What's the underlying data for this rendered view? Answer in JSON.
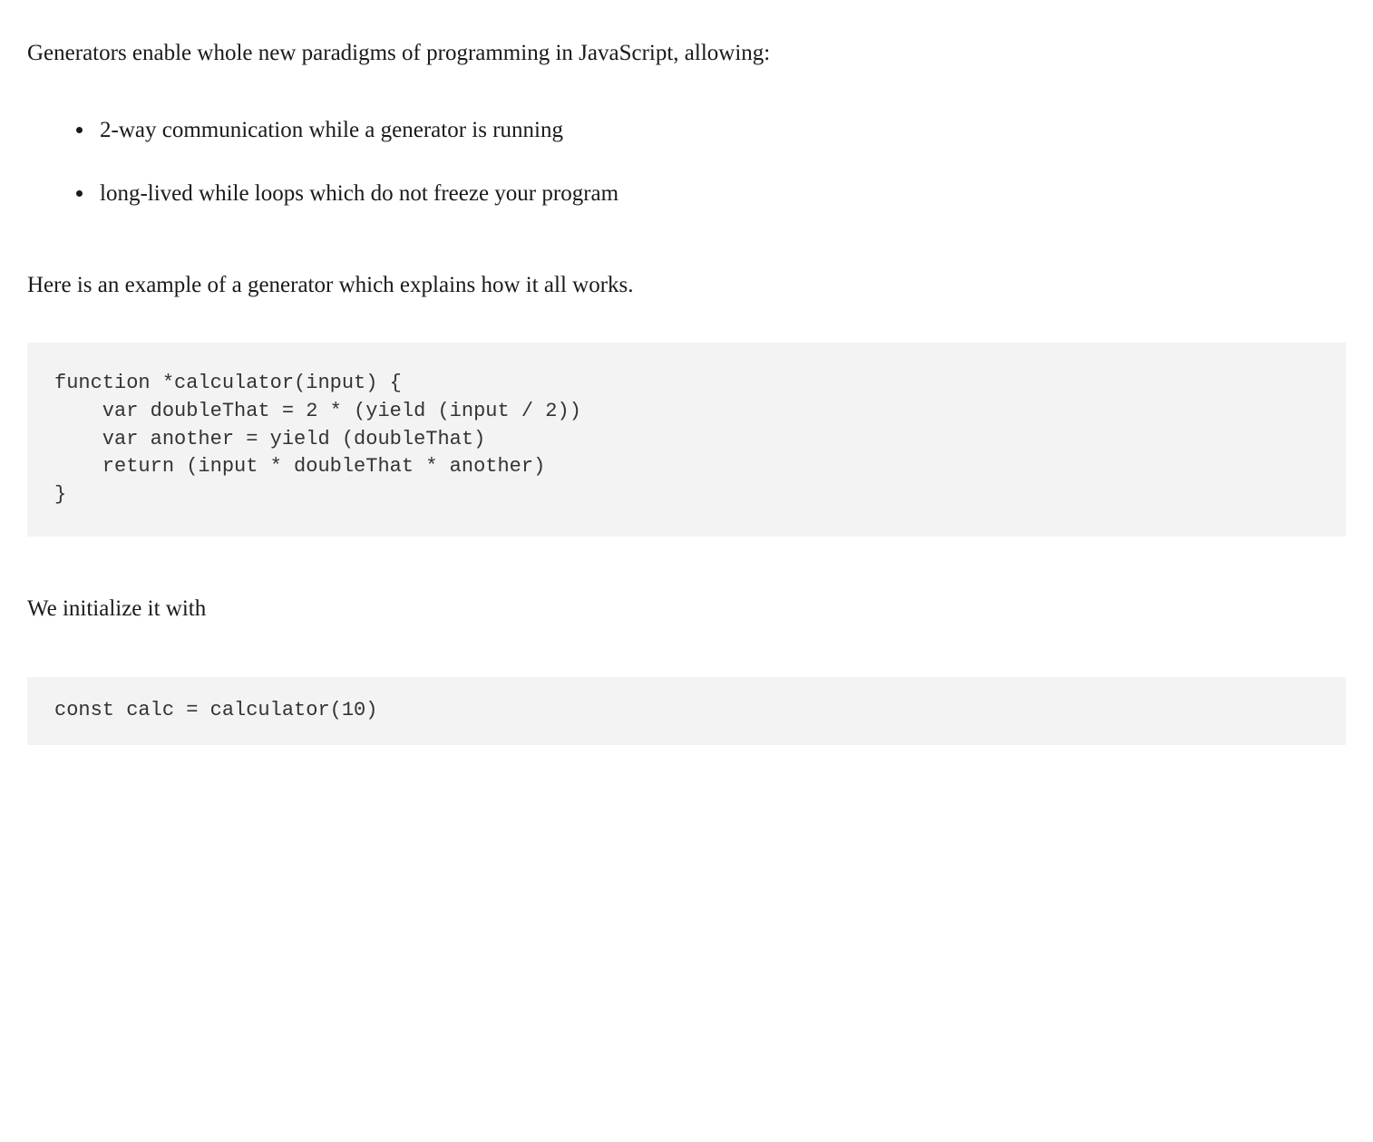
{
  "intro": "Generators enable whole new paradigms of programming in JavaScript, allowing:",
  "bullets": [
    "2-way communication while a generator is running",
    "long-lived while loops which do not freeze your program"
  ],
  "example_intro": "Here is an example of a generator which explains how it all works.",
  "code_block_1": "function *calculator(input) {\n    var doubleThat = 2 * (yield (input / 2))\n    var another = yield (doubleThat)\n    return (input * doubleThat * another)\n}",
  "initialize_text": "We initialize it with",
  "code_block_2": "const calc = calculator(10)"
}
